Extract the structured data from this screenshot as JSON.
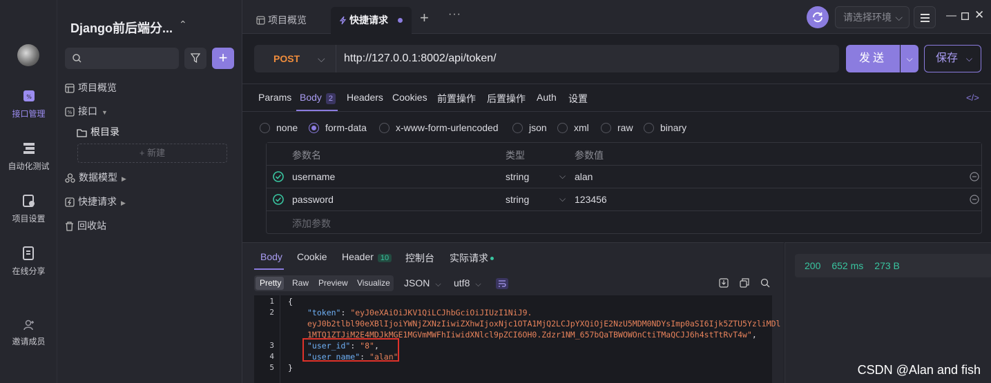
{
  "rail": {
    "items": [
      {
        "label": "接口管理",
        "icon": "api-management-icon"
      },
      {
        "label": "自动化测试",
        "icon": "automation-test-icon"
      },
      {
        "label": "项目设置",
        "icon": "project-settings-icon"
      },
      {
        "label": "在线分享",
        "icon": "online-share-icon"
      },
      {
        "label": "邀请成员",
        "icon": "invite-member-icon"
      }
    ]
  },
  "tree": {
    "project_name": "Django前后端分...",
    "items": [
      {
        "label": "项目概览"
      },
      {
        "label": "接口"
      },
      {
        "label": "根目录"
      },
      {
        "label": "数据模型"
      },
      {
        "label": "快捷请求"
      },
      {
        "label": "回收站"
      }
    ],
    "new_label": "+ 新建"
  },
  "tabs": {
    "overview": "项目概览",
    "quick": "快捷请求",
    "env_placeholder": "请选择环境"
  },
  "request": {
    "method": "POST",
    "url": "http://127.0.0.1:8002/api/token/",
    "send": "发送",
    "save": "保存"
  },
  "req_tabs": {
    "params": "Params",
    "body": "Body",
    "body_count": "2",
    "headers": "Headers",
    "cookies": "Cookies",
    "pre": "前置操作",
    "post": "后置操作",
    "auth": "Auth",
    "settings": "设置"
  },
  "body_types": [
    "none",
    "form-data",
    "x-www-form-urlencoded",
    "json",
    "xml",
    "raw",
    "binary"
  ],
  "params_table": {
    "headers": [
      "参数名",
      "类型",
      "参数值"
    ],
    "rows": [
      {
        "name": "username",
        "type": "string",
        "value": "alan"
      },
      {
        "name": "password",
        "type": "string",
        "value": "123456"
      }
    ],
    "add_placeholder": "添加参数"
  },
  "response": {
    "tabs": {
      "body": "Body",
      "cookie": "Cookie",
      "header": "Header",
      "header_count": "10",
      "console": "控制台",
      "actual": "实际请求"
    },
    "views": [
      "Pretty",
      "Raw",
      "Preview",
      "Visualize"
    ],
    "format": "JSON",
    "encoding": "utf8",
    "status": "200",
    "time": "652 ms",
    "size": "273 B",
    "lines": [
      "1",
      "2",
      "",
      "",
      "3",
      "4",
      "5"
    ],
    "code": {
      "open": "{",
      "token_key": "\"token\"",
      "token_val_1": "\"eyJ0eXAiOiJKV1QiLCJhbGciOiJIUzI1NiJ9.",
      "token_val_2": "eyJ0b2tlbl90eXBlIjoiYWNjZXNzIiwiZXhwIjoxNjc1OTA1MjQ2LCJpYXQiOjE2NzU5MDM0NDYsImp0aSI6Ijk5ZTU5YzliMDl",
      "token_val_3": "1MTQ1ZTJiM2E4MDJkMGE1MGVmMWFhIiwidXNlcl9pZCI6OH0.Zdzr1NM_657bQaTBWOWOnCtiTMaQCJJ6h4stTtRvT4w\"",
      "user_id_key": "\"user_id\"",
      "user_id_val": "\"8\"",
      "user_name_key": "\"user_name\"",
      "user_name_val": "\"alan\"",
      "close": "}"
    }
  },
  "watermark": "CSDN @Alan and fish",
  "colors": {
    "accent": "#8b7cdf",
    "method": "#f08d3c",
    "success": "#39c5a0",
    "highlight": "#e0322a"
  }
}
